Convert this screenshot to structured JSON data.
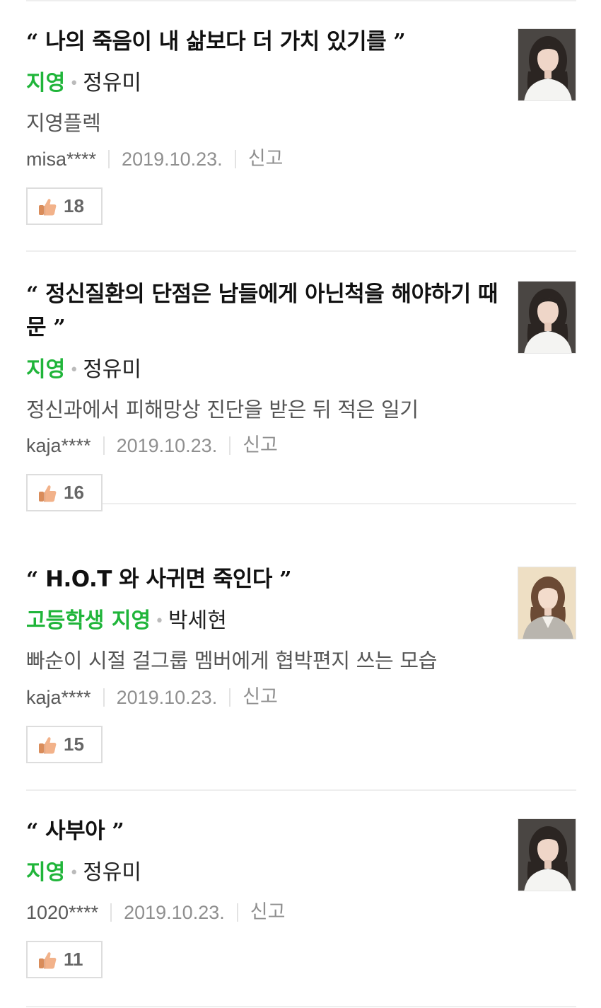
{
  "comments": [
    {
      "quote": "나의 죽음이 내 삶보다 더 가치 있기를",
      "role": "지영",
      "actor": "정유미",
      "description": "지영플렉",
      "user": "misa****",
      "date": "2019.10.23.",
      "report_label": "신고",
      "likes": "18",
      "photo": "actor-portrait-dark"
    },
    {
      "quote": "정신질환의 단점은 남들에게 아닌척을 해야하기 때문",
      "role": "지영",
      "actor": "정유미",
      "description": "정신과에서 피해망상 진단을 받은 뒤 적은 일기",
      "user": "kaja****",
      "date": "2019.10.23.",
      "report_label": "신고",
      "likes": "16",
      "photo": "actor-portrait-dark"
    },
    {
      "quote": "H.O.T 와 사귀면 죽인다",
      "role": "고등학생 지영",
      "actor": "박세현",
      "description": "빠순이 시절 걸그룹 멤버에게 협박편지 쓰는 모습",
      "user": "kaja****",
      "date": "2019.10.23.",
      "report_label": "신고",
      "likes": "15",
      "photo": "actor-portrait-light"
    },
    {
      "quote": "사부아",
      "role": "지영",
      "actor": "정유미",
      "description": "",
      "user": "1020****",
      "date": "2019.10.23.",
      "report_label": "신고",
      "likes": "11",
      "photo": "actor-portrait-dark"
    }
  ],
  "quote_open": "“",
  "quote_close": "”",
  "dot": "•",
  "colors": {
    "role": "#20b53a",
    "divider": "#eeeeee",
    "button_border": "#dddddd"
  }
}
